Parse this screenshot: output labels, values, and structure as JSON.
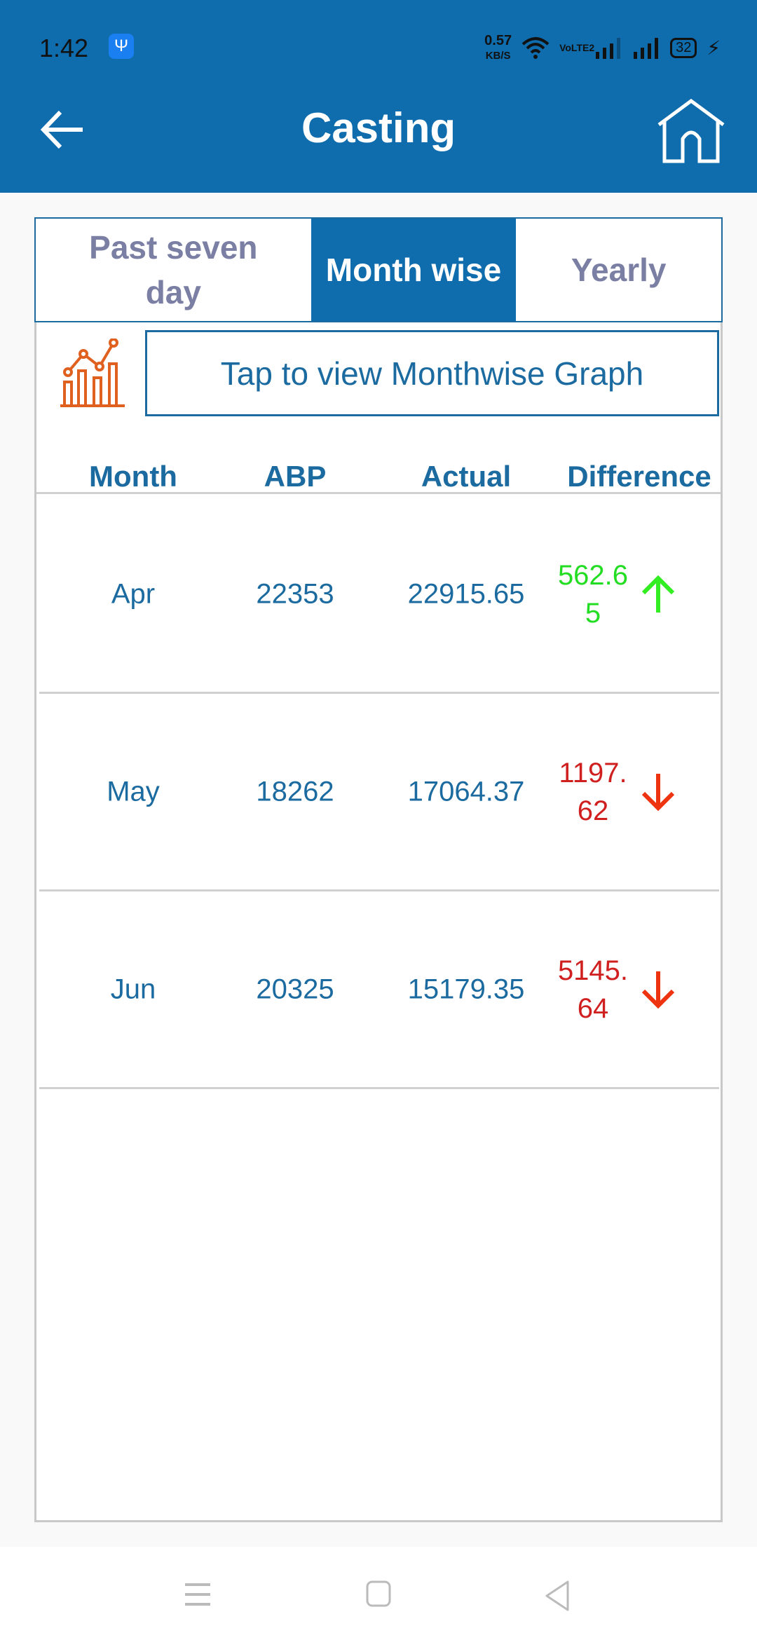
{
  "status_bar": {
    "time": "1:42",
    "speed": "0.57",
    "speed_unit": "KB/S",
    "network": "VoLTE2",
    "battery": "32"
  },
  "header": {
    "title": "Casting"
  },
  "tabs": [
    {
      "label": "Past seven day",
      "active": false
    },
    {
      "label": "Month wise",
      "active": true
    },
    {
      "label": "Yearly",
      "active": false
    }
  ],
  "graph_button": {
    "label": "Tap to view Monthwise Graph"
  },
  "table": {
    "columns": [
      "Month",
      "ABP",
      "Actual",
      "Difference"
    ],
    "rows": [
      {
        "month": "Apr",
        "abp": "22353",
        "actual": "22915.65",
        "difference": "562.65",
        "trend": "up"
      },
      {
        "month": "May",
        "abp": "18262",
        "actual": "17064.37",
        "difference": "1197.62",
        "trend": "down"
      },
      {
        "month": "Jun",
        "abp": "20325",
        "actual": "15179.35",
        "difference": "5145.64",
        "trend": "down"
      }
    ]
  },
  "colors": {
    "primary": "#0f6cad",
    "text": "#1b6aa0",
    "up": "#22dd22",
    "down_text": "#d01f1f",
    "down_arrow": "#ee3311",
    "graph_icon": "#e0601f"
  }
}
